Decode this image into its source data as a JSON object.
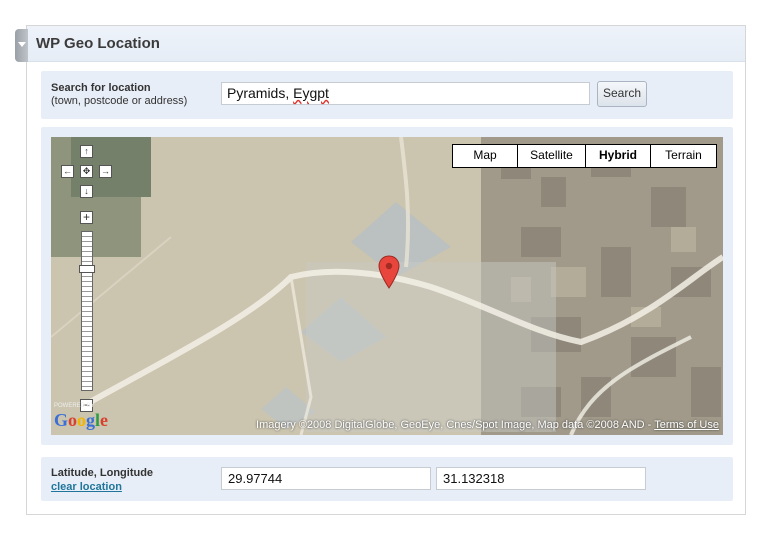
{
  "panel": {
    "title": "WP Geo Location"
  },
  "search": {
    "label": "Search for location",
    "hint": "(town, postcode or address)",
    "value_first": "Pyramids,",
    "value_misspelled": "Eygpt",
    "button": "Search"
  },
  "map": {
    "types": [
      "Map",
      "Satellite",
      "Hybrid",
      "Terrain"
    ],
    "active_type": "Hybrid",
    "controls": {
      "pan_up": "↑",
      "pan_left": "←",
      "pan_center": "✥",
      "pan_right": "→",
      "pan_down": "↓",
      "zoom_in": "+",
      "zoom_out": "−"
    },
    "powered_by": "POWERED BY",
    "logo_text": "Google",
    "copyright": "Imagery ©2008 DigitalGlobe, GeoEye, Cnes/Spot Image, Map data ©2008 AND -",
    "terms_link": "Terms of Use"
  },
  "coords": {
    "label": "Latitude, Longitude",
    "clear_link": "clear location",
    "latitude": "29.97744",
    "longitude": "31.132318"
  },
  "colors": {
    "link": "#21759b",
    "row_bg": "#e8eef7",
    "marker": "#e8453c"
  }
}
